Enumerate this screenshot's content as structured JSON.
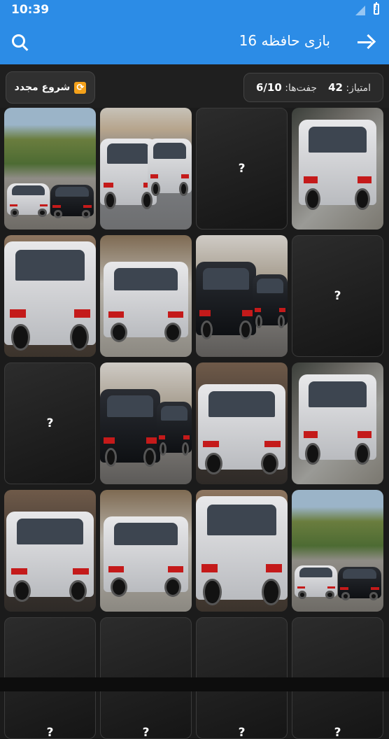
{
  "status": {
    "time": "10:39"
  },
  "appbar": {
    "title": "بازی حافظه 16"
  },
  "toolbar": {
    "restart_label": "شروع مجدد",
    "score_label": "امتیاز:",
    "score_value": "42",
    "pairs_label": "جفت‌ها:",
    "pairs_value": "6/10"
  },
  "cards": [
    {
      "state": "revealed",
      "photo": "two-cars-hillside"
    },
    {
      "state": "revealed",
      "photo": "silver-car-rear-plate"
    },
    {
      "state": "hidden",
      "label": "?"
    },
    {
      "state": "revealed",
      "photo": "silver-car-tilted"
    },
    {
      "state": "revealed",
      "photo": "silver-car-rear-close"
    },
    {
      "state": "revealed",
      "photo": "silver-car-front-building"
    },
    {
      "state": "revealed",
      "photo": "black-car-rear"
    },
    {
      "state": "hidden",
      "label": "?"
    },
    {
      "state": "hidden",
      "label": "?"
    },
    {
      "state": "revealed",
      "photo": "black-car-rear"
    },
    {
      "state": "revealed",
      "photo": "silver-car-front-view"
    },
    {
      "state": "revealed",
      "photo": "silver-car-tilted"
    },
    {
      "state": "revealed",
      "photo": "silver-car-front-view"
    },
    {
      "state": "revealed",
      "photo": "silver-car-front-building"
    },
    {
      "state": "revealed",
      "photo": "silver-car-rear-close"
    },
    {
      "state": "revealed",
      "photo": "two-cars-hillside"
    },
    {
      "state": "hidden",
      "label": "?"
    },
    {
      "state": "hidden",
      "label": "?"
    },
    {
      "state": "hidden",
      "label": "?"
    },
    {
      "state": "hidden",
      "label": "?"
    }
  ],
  "colors": {
    "accent": "#2c8ce6",
    "background": "#1b1b1b",
    "restart_icon": "#f4a11a"
  }
}
